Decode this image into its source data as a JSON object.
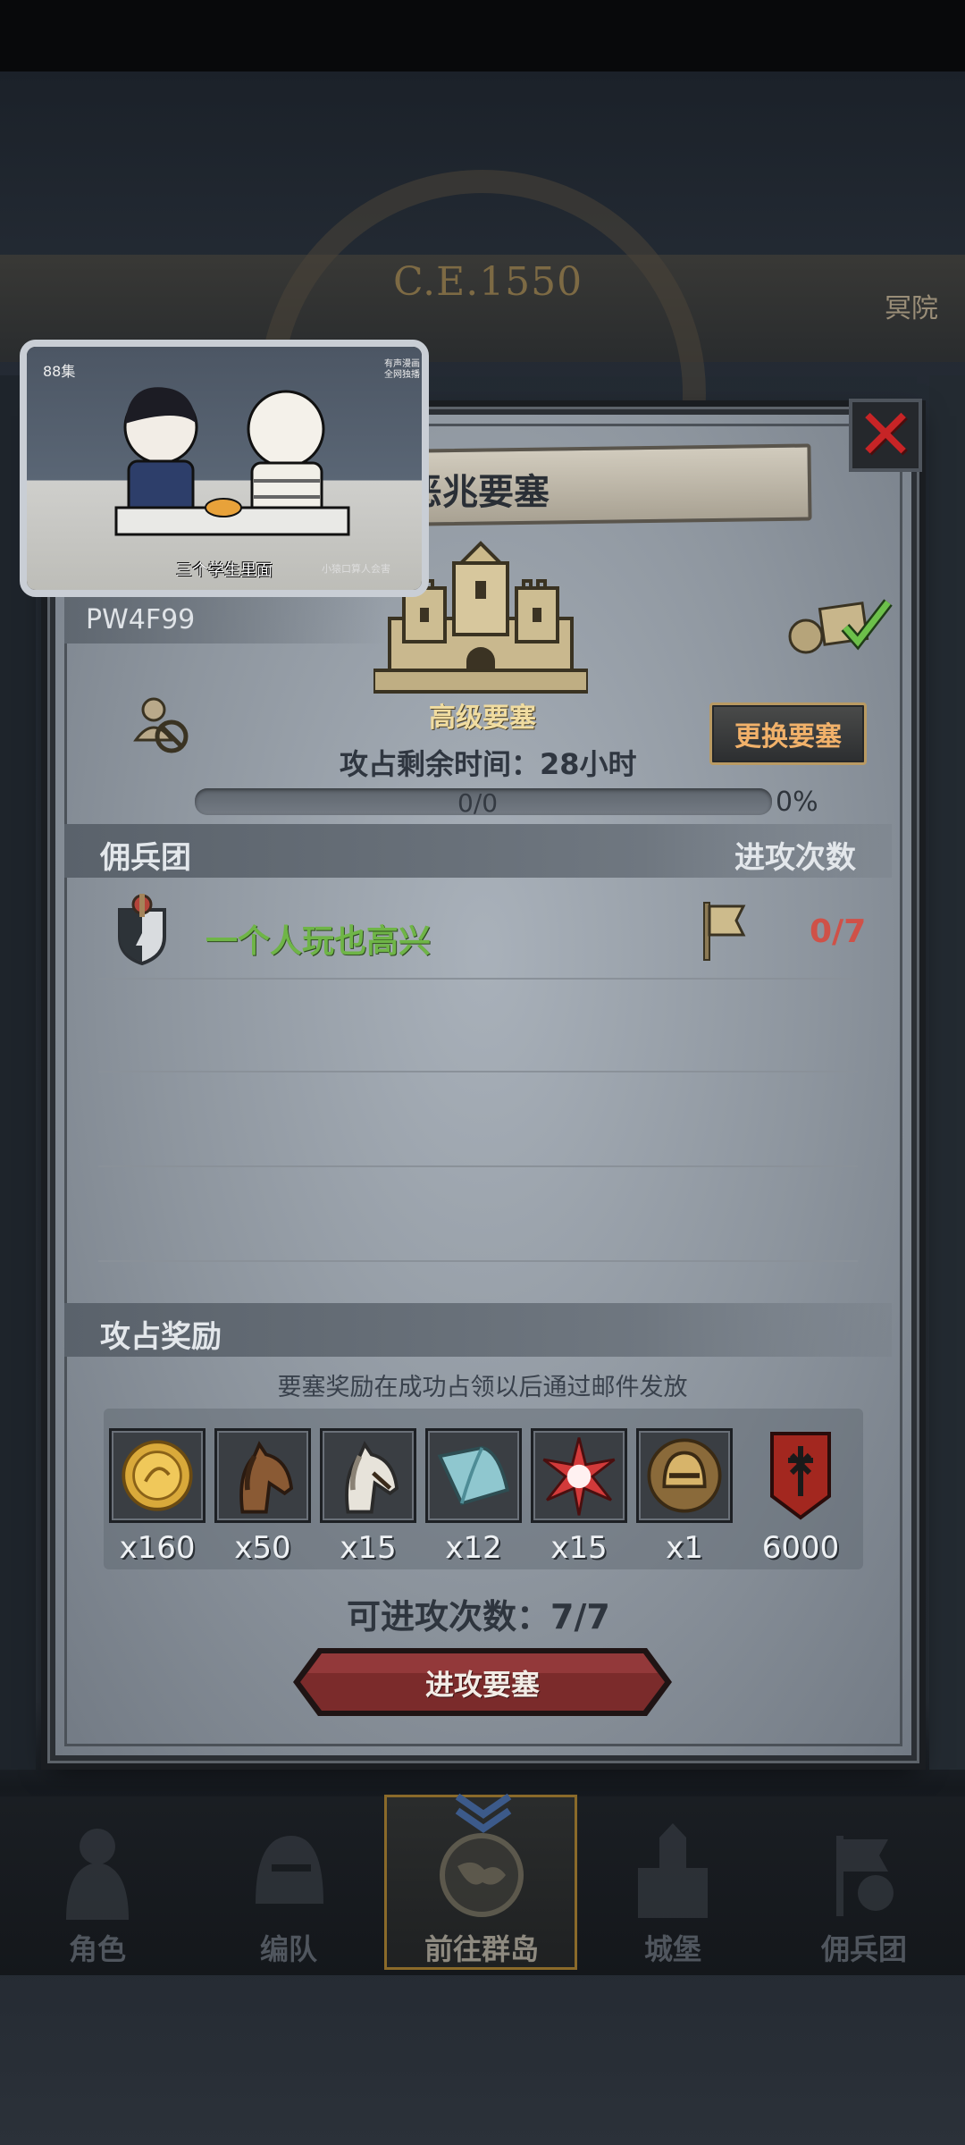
{
  "background": {
    "year": "C.E.1550",
    "corner_text": "冥院"
  },
  "video": {
    "episode": "88集",
    "caption": "三个学生里面",
    "caption_small": "小猿口算人会害",
    "top_right": "有声漫画 全网独播"
  },
  "dialog": {
    "title": "恶兆要塞",
    "code": "PW4F99",
    "fortress_label": "高级要塞",
    "change_button": "更换要塞",
    "time_label": "攻占剩余时间：28小时",
    "progress_text": "0/0",
    "progress_pct": "0%",
    "progress_fraction": 0,
    "merc_section": {
      "title": "佣兵团",
      "right_title": "进攻次数"
    },
    "mercenaries": [
      {
        "name": "一个人玩也高兴",
        "attacks": "0/7"
      }
    ],
    "reward_section": {
      "title": "攻占奖励"
    },
    "reward_note": "要塞奖励在成功占领以后通过邮件发放",
    "rewards": [
      {
        "icon": "gold-coin-icon",
        "qty": "x160"
      },
      {
        "icon": "brown-horse-icon",
        "qty": "x50"
      },
      {
        "icon": "white-horse-icon",
        "qty": "x15"
      },
      {
        "icon": "cloth-roll-icon",
        "qty": "x12"
      },
      {
        "icon": "red-star-icon",
        "qty": "x15"
      },
      {
        "icon": "knight-helmet-icon",
        "qty": "x1"
      },
      {
        "icon": "red-banner-icon",
        "qty": "6000"
      }
    ],
    "available_attacks": "可进攻次数：7/7",
    "attack_button": "进攻要塞"
  },
  "bottom_nav": [
    {
      "label": "角色",
      "icon": "knight-icon"
    },
    {
      "label": "编队",
      "icon": "helmet-icon"
    },
    {
      "label": "前往群岛",
      "icon": "globe-icon"
    },
    {
      "label": "城堡",
      "icon": "castle-icon"
    },
    {
      "label": "佣兵团",
      "icon": "mercenary-icon"
    }
  ],
  "colors": {
    "accent_gold": "#b99a63",
    "merc_name": "#6fb547",
    "attack_count": "#cf5148",
    "close_red": "#c72426",
    "attack_button": "#7a2a2a"
  }
}
